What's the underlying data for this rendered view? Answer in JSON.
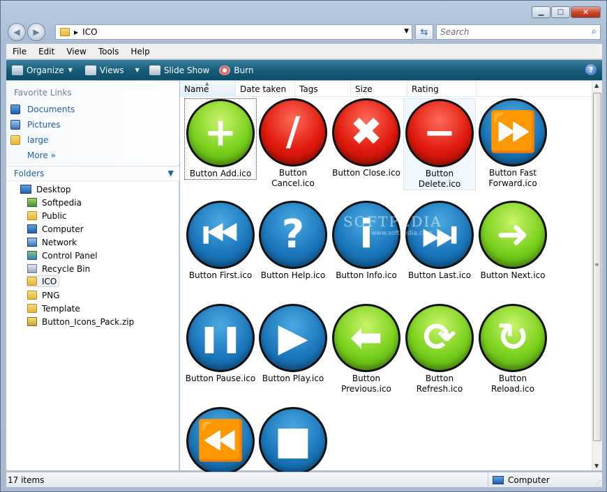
{
  "window": {
    "minimize": "▁",
    "maximize": "□",
    "close": "✕"
  },
  "address": {
    "path": "ICO",
    "search_placeholder": "Search"
  },
  "menu": [
    "File",
    "Edit",
    "View",
    "Tools",
    "Help"
  ],
  "toolbar": {
    "organize": "Organize",
    "views": "Views",
    "slideshow": "Slide Show",
    "burn": "Burn"
  },
  "favorites": {
    "title": "Favorite Links",
    "items": [
      "Documents",
      "Pictures",
      "large"
    ],
    "more": "More"
  },
  "folders": {
    "title": "Folders",
    "tree": [
      "Desktop",
      "Softpedia",
      "Public",
      "Computer",
      "Network",
      "Control Panel",
      "Recycle Bin",
      "ICO",
      "PNG",
      "Template",
      "Button_Icons_Pack.zip"
    ]
  },
  "columns": [
    "Name",
    "Date taken",
    "Tags",
    "Size",
    "Rating"
  ],
  "files": [
    {
      "name": "Button Add.ico",
      "color": "green",
      "glyph": "+"
    },
    {
      "name": "Button Cancel.ico",
      "color": "red",
      "glyph": "/"
    },
    {
      "name": "Button Close.ico",
      "color": "red",
      "glyph": "✖"
    },
    {
      "name": "Button Delete.ico",
      "color": "red",
      "glyph": "−"
    },
    {
      "name": "Button Fast Forward.ico",
      "color": "blue",
      "glyph": "⏩"
    },
    {
      "name": "Button First.ico",
      "color": "blue",
      "glyph": "⏮"
    },
    {
      "name": "Button Help.ico",
      "color": "blue",
      "glyph": "?"
    },
    {
      "name": "Button Info.ico",
      "color": "blue",
      "glyph": "i"
    },
    {
      "name": "Button Last.ico",
      "color": "blue",
      "glyph": "⏭"
    },
    {
      "name": "Button Next.ico",
      "color": "green",
      "glyph": "➜"
    },
    {
      "name": "Button Pause.ico",
      "color": "blue",
      "glyph": "❚❚"
    },
    {
      "name": "Button Play.ico",
      "color": "blue",
      "glyph": "▶"
    },
    {
      "name": "Button Previous.ico",
      "color": "green",
      "glyph": "⬅"
    },
    {
      "name": "Button Refresh.ico",
      "color": "green",
      "glyph": "⟳"
    },
    {
      "name": "Button Reload.ico",
      "color": "green",
      "glyph": "↻"
    },
    {
      "name": "",
      "color": "blue",
      "glyph": "⏪"
    },
    {
      "name": "",
      "color": "blue",
      "glyph": "■"
    }
  ],
  "watermark": {
    "brand": "SOFTPEDIA",
    "url": "www.softpedia.com"
  },
  "status": {
    "count": "17 items",
    "location": "Computer"
  }
}
